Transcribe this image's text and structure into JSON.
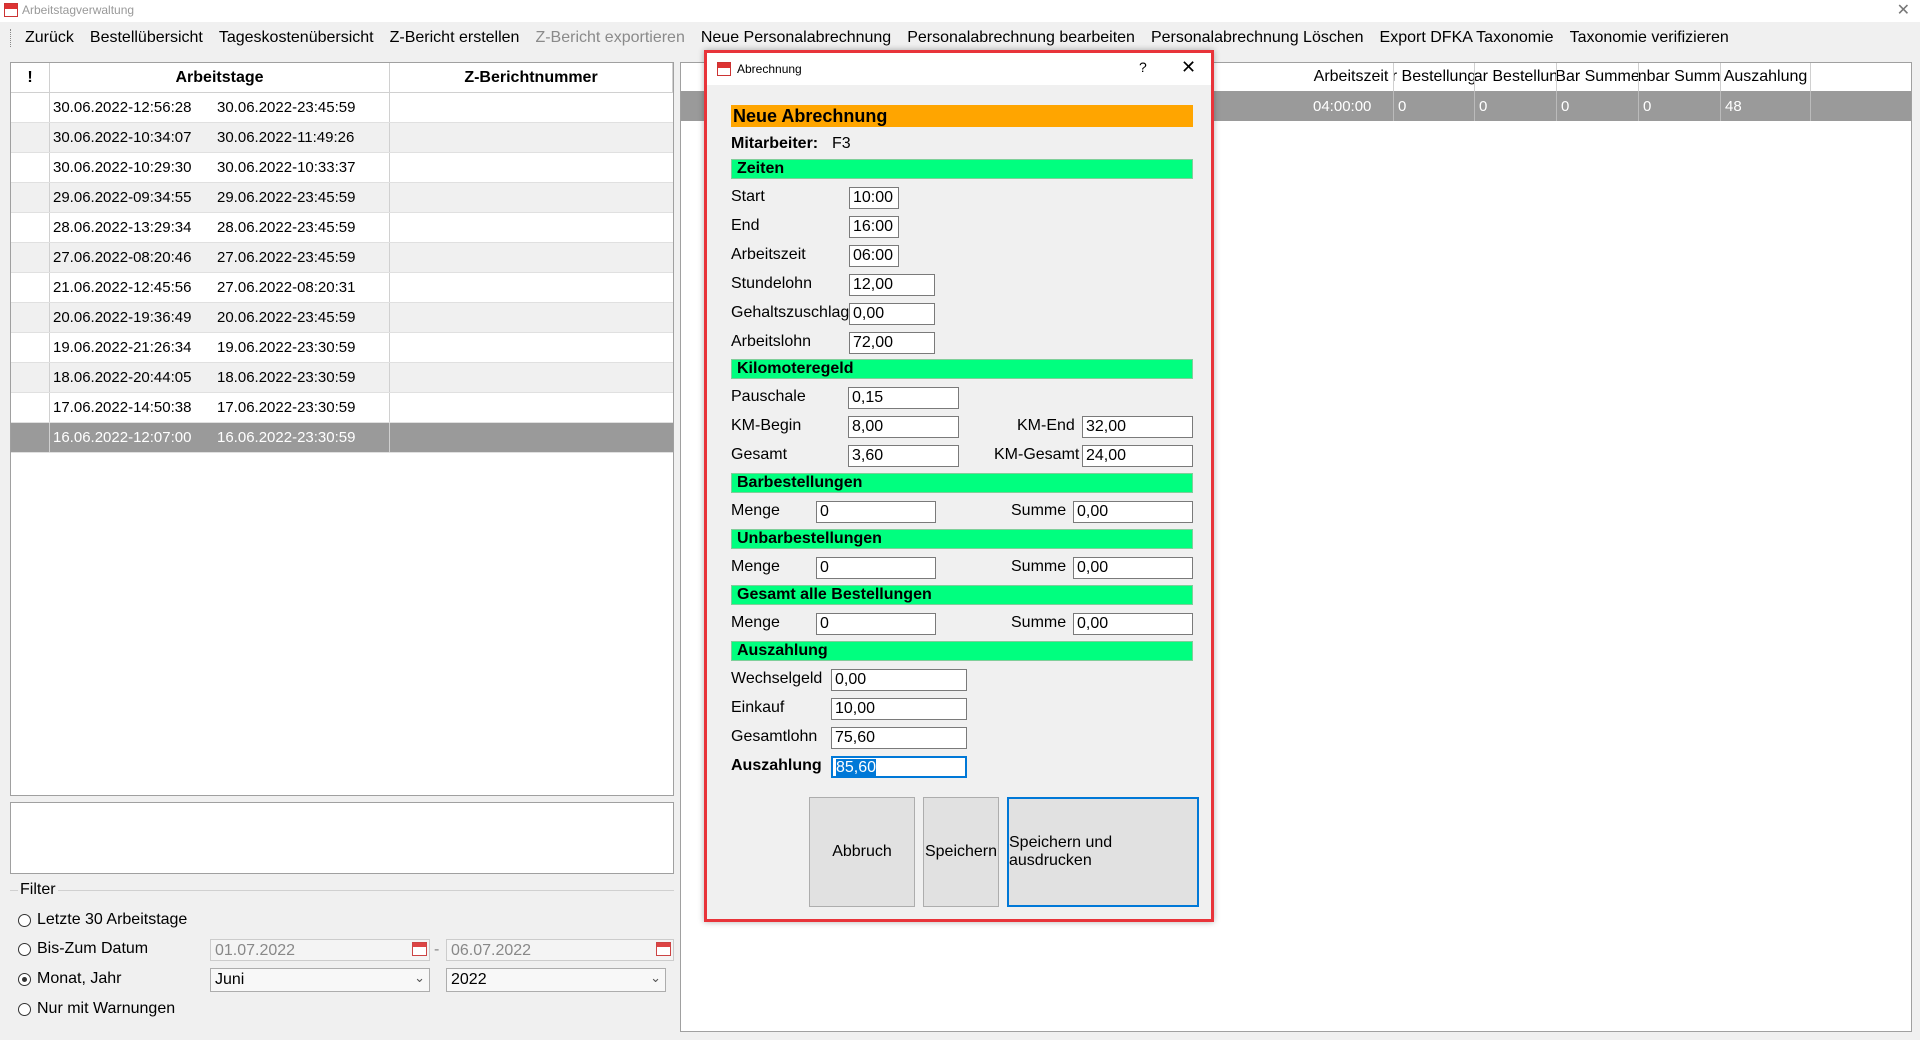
{
  "window": {
    "title": "Arbeitstagverwaltung",
    "close_glyph": "✕"
  },
  "menu": [
    {
      "label": "Zurück",
      "disabled": false
    },
    {
      "label": "Bestellübersicht",
      "disabled": false
    },
    {
      "label": "Tageskostenübersicht",
      "disabled": false
    },
    {
      "label": "Z-Bericht erstellen",
      "disabled": false
    },
    {
      "label": "Z-Bericht exportieren",
      "disabled": true
    },
    {
      "label": "Neue Personalabrechnung",
      "disabled": false
    },
    {
      "label": "Personalabrechnung bearbeiten",
      "disabled": false
    },
    {
      "label": "Personalabrechnung Löschen",
      "disabled": false
    },
    {
      "label": "Export DFKA Taxonomie",
      "disabled": false
    },
    {
      "label": "Taxonomie verifizieren",
      "disabled": false
    }
  ],
  "list": {
    "headers": {
      "flag": "!",
      "arbeitstage": "Arbeitstage",
      "zbericht": "Z-Berichtnummer"
    },
    "rows": [
      {
        "start": "30.06.2022-12:56:28",
        "end": "30.06.2022-23:45:59"
      },
      {
        "start": "30.06.2022-10:34:07",
        "end": "30.06.2022-11:49:26"
      },
      {
        "start": "30.06.2022-10:29:30",
        "end": "30.06.2022-10:33:37"
      },
      {
        "start": "29.06.2022-09:34:55",
        "end": "29.06.2022-23:45:59"
      },
      {
        "start": "28.06.2022-13:29:34",
        "end": "28.06.2022-23:45:59"
      },
      {
        "start": "27.06.2022-08:20:46",
        "end": "27.06.2022-23:45:59"
      },
      {
        "start": "21.06.2022-12:45:56",
        "end": "27.06.2022-08:20:31"
      },
      {
        "start": "20.06.2022-19:36:49",
        "end": "20.06.2022-23:45:59"
      },
      {
        "start": "19.06.2022-21:26:34",
        "end": "19.06.2022-23:30:59"
      },
      {
        "start": "18.06.2022-20:44:05",
        "end": "18.06.2022-23:30:59"
      },
      {
        "start": "17.06.2022-14:50:38",
        "end": "17.06.2022-23:30:59"
      },
      {
        "start": "16.06.2022-12:07:00",
        "end": "16.06.2022-23:30:59"
      }
    ],
    "selected_index": 11
  },
  "filter": {
    "legend": "Filter",
    "options": [
      {
        "label": "Letzte 30 Arbeitstage",
        "checked": false
      },
      {
        "label": "Bis-Zum Datum",
        "checked": false
      },
      {
        "label": "Monat, Jahr",
        "checked": true
      },
      {
        "label": "Nur mit Warnungen",
        "checked": false
      }
    ],
    "date_from": "01.07.2022",
    "date_sep": "-",
    "date_to": "06.07.2022",
    "month": "Juni",
    "year": "2022"
  },
  "right_table": {
    "headers": [
      "Arbeitszeit",
      "ar Bestellunge",
      "bar Bestellunç",
      "Bar Summe",
      "Jnbar Summe",
      "Auszahlung"
    ],
    "row": [
      "04:00:00",
      "0",
      "0",
      "0",
      "0",
      "48"
    ]
  },
  "dialog": {
    "title": "Abrechnung",
    "help_glyph": "?",
    "close_glyph": "✕",
    "heading": "Neue Abrechnung",
    "mitarbeiter_label": "Mitarbeiter:",
    "mitarbeiter_value": "F3",
    "sections": {
      "zeiten": "Zeiten",
      "kilometer": "Kilomoteregeld",
      "bar": "Barbestellungen",
      "unbar": "Unbarbestellungen",
      "gesamt": "Gesamt alle Bestellungen",
      "auszahlung": "Auszahlung"
    },
    "zeiten": {
      "start_label": "Start",
      "start": "10:00",
      "end_label": "End",
      "end": "16:00",
      "arbeitszeit_label": "Arbeitszeit",
      "arbeitszeit": "06:00",
      "stundelohn_label": "Stundelohn",
      "stundelohn": "12,00",
      "gehaltszuschlag_label": "Gehaltszuschlag",
      "gehaltszuschlag": "0,00",
      "arbeitslohn_label": "Arbeitslohn",
      "arbeitslohn": "72,00"
    },
    "km": {
      "pauschale_label": "Pauschale",
      "pauschale": "0,15",
      "begin_label": "KM-Begin",
      "begin": "8,00",
      "end_label": "KM-End",
      "end": "32,00",
      "gesamt_label": "Gesamt",
      "gesamt": "3,60",
      "km_gesamt_label": "KM-Gesamt",
      "km_gesamt": "24,00"
    },
    "menge_label": "Menge",
    "summe_label": "Summe",
    "bar": {
      "menge": "0",
      "summe": "0,00"
    },
    "unbar": {
      "menge": "0",
      "summe": "0,00"
    },
    "gesamt": {
      "menge": "0",
      "summe": "0,00"
    },
    "payout": {
      "wechselgeld_label": "Wechselgeld",
      "wechselgeld": "0,00",
      "einkauf_label": "Einkauf",
      "einkauf": "10,00",
      "gesamtlohn_label": "Gesamtlohn",
      "gesamtlohn": "75,60",
      "auszahlung_label": "Auszahlung",
      "auszahlung": "85,60"
    },
    "buttons": {
      "abbruch": "Abbruch",
      "speichern": "Speichern",
      "speichern_drucken": "Speichern und ausdrucken"
    }
  },
  "colors": {
    "accent_orange": "#ffa500",
    "section_green": "#00ff7f",
    "dialog_border": "#e8343a",
    "selection_gray": "#9a9a9a",
    "focus_blue": "#0078d7"
  }
}
